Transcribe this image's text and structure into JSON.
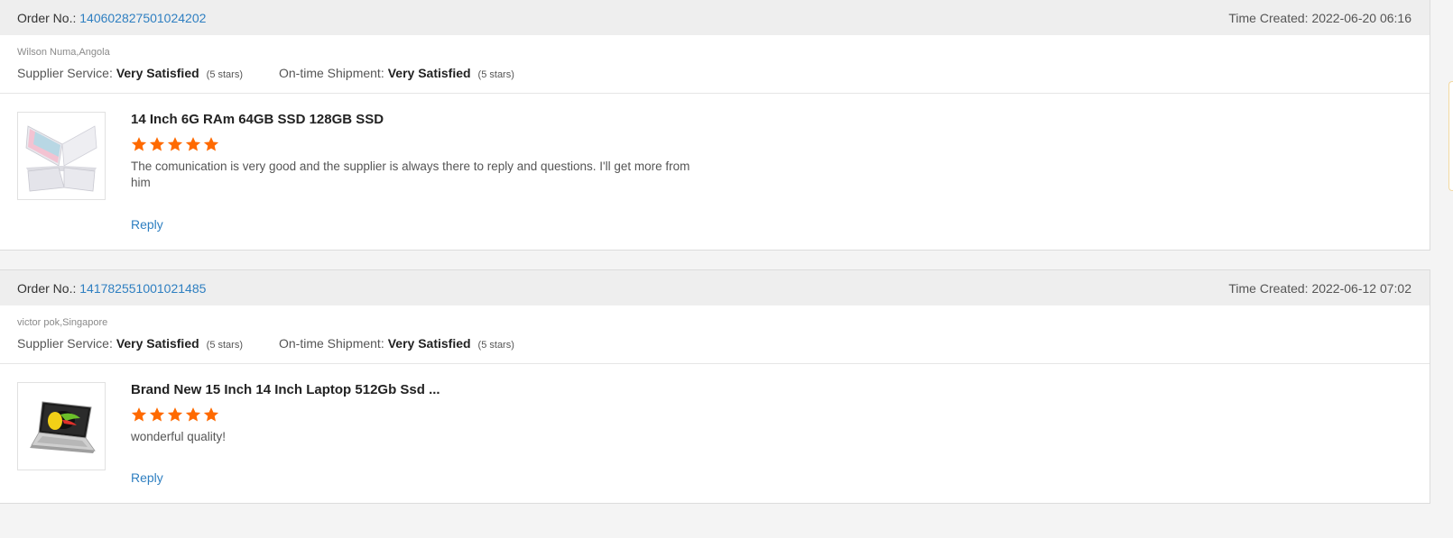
{
  "reviews": [
    {
      "order_label": "Order No.:",
      "order_no": "140602827501024202",
      "time_label": "Time Created:",
      "time_created": "2022-06-20 06:16",
      "buyer": "Wilson Numa,Angola",
      "supplier_service_label": "Supplier Service:",
      "supplier_service_value": "Very Satisfied",
      "supplier_service_stars": "(5 stars)",
      "shipment_label": "On-time Shipment:",
      "shipment_value": "Very Satisfied",
      "shipment_stars": "(5 stars)",
      "product_title": "14 Inch 6G RAm 64GB SSD 128GB SSD",
      "rating": 5,
      "review_text": "The comunication is very good and the supplier is always there to reply and questions. I'll get more from him",
      "reply_label": "Reply",
      "thumbnail": "laptop-x-pink-icon"
    },
    {
      "order_label": "Order No.:",
      "order_no": "141782551001021485",
      "time_label": "Time Created:",
      "time_created": "2022-06-12 07:02",
      "buyer": "victor pok,Singapore",
      "supplier_service_label": "Supplier Service:",
      "supplier_service_value": "Very Satisfied",
      "supplier_service_stars": "(5 stars)",
      "shipment_label": "On-time Shipment:",
      "shipment_value": "Very Satisfied",
      "shipment_stars": "(5 stars)",
      "product_title": "Brand New 15 Inch 14 Inch Laptop 512Gb Ssd ...",
      "rating": 5,
      "review_text": "wonderful quality!",
      "reply_label": "Reply",
      "thumbnail": "laptop-toucan-icon"
    }
  ],
  "colors": {
    "link": "#2e7fc1",
    "star": "#ff6a00",
    "header_bg": "#eeeeee"
  }
}
